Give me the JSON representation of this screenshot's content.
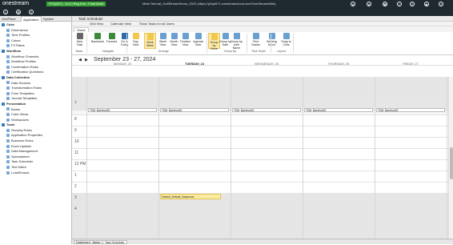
{
  "topbar": {
    "logo": "onestream",
    "build_tag": "FFQA571 : 8.4.0 Reg Env : Final Build",
    "header_title": "Meta Tehrudl_GolfStreamDemo_2022 (https://p2qa571.onestreamcloud.com/OneStreamWeb)"
  },
  "left_panel": {
    "tabs": [
      "OnePlace",
      "Application",
      "System"
    ],
    "items": [
      {
        "label": "Cube",
        "level": 0,
        "header": true
      },
      {
        "label": "Dimensions",
        "level": 1
      },
      {
        "label": "Time Profiles",
        "level": 1
      },
      {
        "label": "Cubes",
        "level": 1
      },
      {
        "label": "FX Rates",
        "level": 1
      },
      {
        "label": "Workflow",
        "level": 0,
        "header": true
      },
      {
        "label": "Workflow Channels",
        "level": 1
      },
      {
        "label": "Workflow Profiles",
        "level": 1
      },
      {
        "label": "Confirmation Rules",
        "level": 1
      },
      {
        "label": "Certification Questions",
        "level": 1
      },
      {
        "label": "Data Collection",
        "level": 0,
        "header": true
      },
      {
        "label": "Data Sources",
        "level": 1
      },
      {
        "label": "Transformation Rules",
        "level": 1
      },
      {
        "label": "Form Templates",
        "level": 1
      },
      {
        "label": "Journal Templates",
        "level": 1
      },
      {
        "label": "Presentation",
        "level": 0,
        "header": true
      },
      {
        "label": "Books",
        "level": 1
      },
      {
        "label": "Cube Views",
        "level": 1
      },
      {
        "label": "Workspaces",
        "level": 1
      },
      {
        "label": "Tools",
        "level": 0,
        "header": true
      },
      {
        "label": "Security Roles",
        "level": 1
      },
      {
        "label": "Application Properties",
        "level": 1
      },
      {
        "label": "Business Rules",
        "level": 1
      },
      {
        "label": "Excel Updater",
        "level": 1
      },
      {
        "label": "Data Management",
        "level": 1
      },
      {
        "label": "Spreadsheet",
        "level": 1
      },
      {
        "label": "Task Scheduler",
        "level": 1
      },
      {
        "label": "Text Editor",
        "level": 1
      },
      {
        "label": "Load/Extract",
        "level": 1
      }
    ]
  },
  "main": {
    "title": "Task Scheduler",
    "toolbar": {
      "grid_view": "Grid View",
      "calendar_view": "Calendar View",
      "show_tasks": "Show Tasks for all Users"
    },
    "ribbon_tab": "Home",
    "ribbon_buttons": [
      "New Task",
      "Backward",
      "Forward",
      "Go to Today",
      "Day View",
      "Work Week",
      "Week View",
      "Month View",
      "Timeline View",
      "Agenda View",
      "Group by None",
      "Group by Date",
      "Group by User Name",
      "Time Scales",
      "Working Hours",
      "Snap to Cells"
    ],
    "ribbon_groups": [
      "Tasks",
      "Navigate",
      "Arrange",
      "Group By",
      "Time Scale",
      "Layout"
    ],
    "date_range": "September 23 - 27, 2024",
    "days": [
      "MONDAY, 23",
      "TUESDAY, 24",
      "WEDNESDAY, 25",
      "THURSDAY, 26",
      "FRIDAY, 27"
    ],
    "hours": [
      "7",
      "8",
      "9",
      "10",
      "11",
      "12 PM",
      "1",
      "2",
      "3",
      "4"
    ],
    "allday_events": [
      "TSM_Bamboo52",
      "TSM_Bamboo52",
      "TSM_Bamboo52",
      "TSM_Bamboo52",
      "TSM_Bamboo52"
    ],
    "event": "Default_Default_Sequence"
  },
  "statusbar": {
    "tabs": [
      "Dashboard - Balan...",
      "Task Scheduler"
    ],
    "zoom": "100%"
  },
  "colors": {
    "accent": "#fce9a8",
    "topbar": "#1f2a30",
    "build": "#3aa335"
  }
}
